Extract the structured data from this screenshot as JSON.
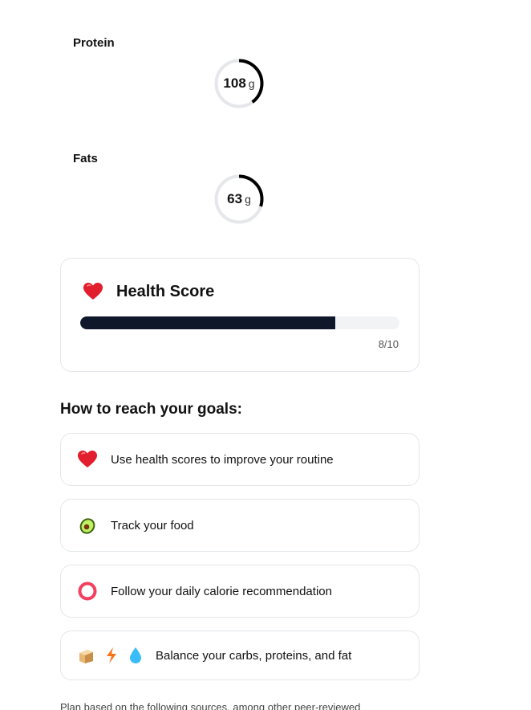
{
  "macros": [
    {
      "label": "Protein",
      "value": "108",
      "unit": "g",
      "progress": 0.4
    },
    {
      "label": "Fats",
      "value": "63",
      "unit": "g",
      "progress": 0.3
    }
  ],
  "health_score": {
    "title": "Health Score",
    "score_text": "8/10",
    "progress": 0.8,
    "icon": "heart-icon"
  },
  "goals": {
    "title": "How to reach your goals:",
    "tips": [
      {
        "text": "Use health scores to improve your routine",
        "icons": [
          "heart-icon"
        ]
      },
      {
        "text": "Track your food",
        "icons": [
          "avocado-icon"
        ]
      },
      {
        "text": "Follow your daily calorie recommendation",
        "icons": [
          "ring-icon"
        ]
      },
      {
        "text": "Balance your carbs, proteins, and fat",
        "icons": [
          "bread-icon",
          "lightning-icon",
          "droplet-icon"
        ]
      }
    ]
  },
  "footer_text": "Plan based on the following sources, among other peer-reviewed",
  "colors": {
    "ring_progress": "#000000",
    "ring_track": "#e5e7eb",
    "health_bar": "#0f172a",
    "heart": "#e11d2e",
    "calorie_ring": "#f43f5e",
    "lightning": "#f97316",
    "droplet": "#38bdf8"
  }
}
